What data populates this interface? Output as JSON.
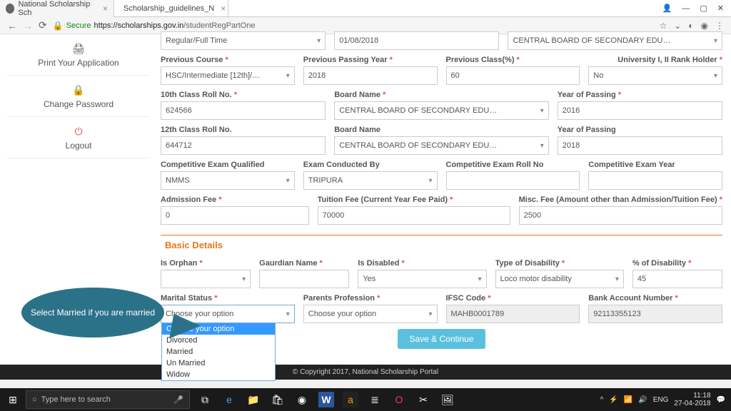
{
  "browser": {
    "tabs": [
      {
        "title": "National Scholarship Sch"
      },
      {
        "title": "Scholarship_guidelines_N"
      }
    ],
    "secure": "Secure",
    "url_host": "https://scholarships.gov.in",
    "url_path": "/studentRegPartOne"
  },
  "sidebar": {
    "print": "Print Your Application",
    "change_pw": "Change Password",
    "logout": "Logout"
  },
  "form": {
    "mode_of_study": {
      "value": "Regular/Full Time"
    },
    "present_start": {
      "value": "01/08/2018"
    },
    "prev_univ": {
      "value": "CENTRAL BOARD OF SECONDARY EDU…"
    },
    "prev_course": {
      "label": "Previous Course",
      "value": "HSC/Intermediate [12th]/…"
    },
    "prev_pass_year": {
      "label": "Previous Passing Year",
      "value": "2018"
    },
    "prev_class_pct": {
      "label": "Previous Class(%)",
      "value": "60"
    },
    "univ_rank": {
      "label": "University I, II Rank Holder",
      "value": "No"
    },
    "roll10_label": "10th Class Roll No.",
    "roll10": "624566",
    "board10_label": "Board Name",
    "board10": "CENTRAL BOARD OF SECONDARY EDU…",
    "yop10_label": "Year of Passing",
    "yop10": "2016",
    "roll12_label": "12th Class Roll No.",
    "roll12": "644712",
    "board12_label": "Board Name",
    "board12": "CENTRAL BOARD OF SECONDARY EDU…",
    "yop12_label": "Year of Passing",
    "yop12": "2018",
    "comp_exam_label": "Competitive Exam Qualified",
    "comp_exam": "NMMS",
    "exam_by_label": "Exam Conducted By",
    "exam_by": "TRIPURA",
    "exam_roll_label": "Competitive Exam Roll No",
    "exam_roll": "",
    "exam_year_label": "Competitive Exam Year",
    "exam_year": "",
    "adm_fee_label": "Admission Fee",
    "adm_fee": "0",
    "tut_fee_label": "Tuition Fee (Current Year Fee Paid)",
    "tut_fee": "70000",
    "misc_fee_label": "Misc. Fee (Amount other than Admission/Tuition Fee)",
    "misc_fee": "2500"
  },
  "basic": {
    "title": "Basic Details",
    "orphan_label": "Is Orphan",
    "guardian_label": "Gaurdian Name",
    "guardian": "",
    "disabled_label": "Is Disabled",
    "disabled": "Yes",
    "disab_type_label": "Type of Disability",
    "disab_type": "Loco motor disability",
    "disab_pct_label": "% of Disability",
    "disab_pct": "45",
    "marital_label": "Marital Status",
    "marital": "Choose your option",
    "parents_prof_label": "Parents Profession",
    "parents_prof": "Choose your option",
    "ifsc_label": "IFSC Code",
    "ifsc": "MAHB0001789",
    "bank_label": "Bank Account Number",
    "bank": "92113355123",
    "marital_options": [
      "Choose your option",
      "Divorced",
      "Married",
      "Un Married",
      "Widow"
    ],
    "save": "Save & Continue"
  },
  "callout": "Select Married if you are married",
  "copyright": "© Copyright 2017, National Scholarship Portal",
  "taskbar": {
    "search_placeholder": "Type here to search",
    "lang": "ENG",
    "time": "11:18",
    "date": "27-04-2018"
  }
}
